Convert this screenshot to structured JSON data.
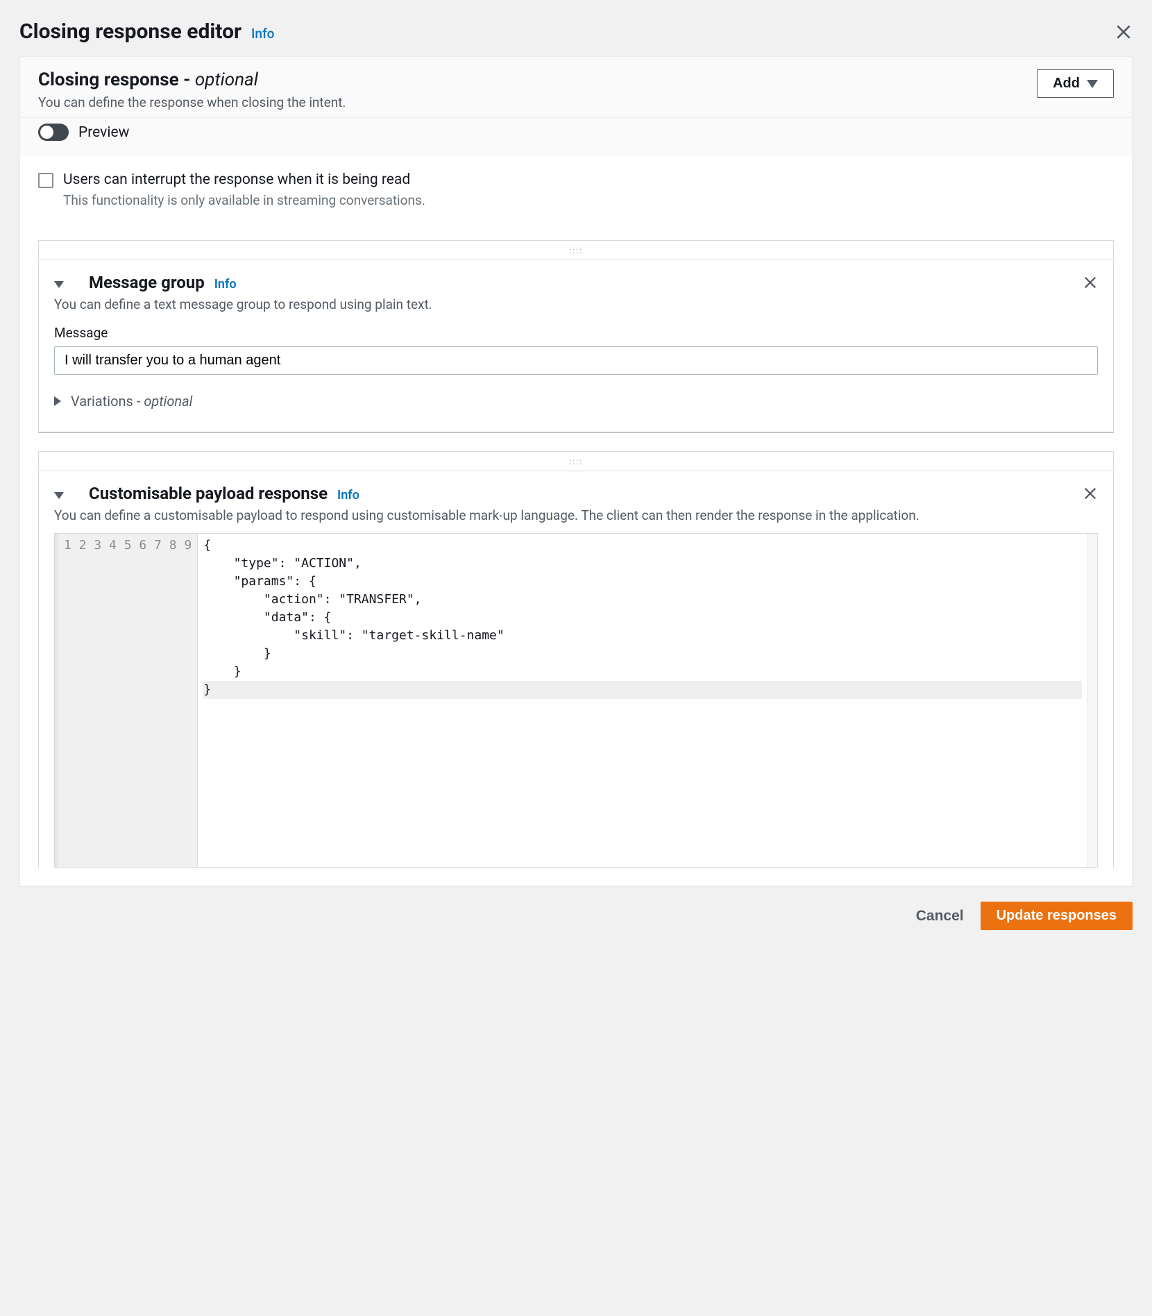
{
  "modal": {
    "title": "Closing response editor",
    "info": "Info"
  },
  "panel": {
    "heading": "Closing response - ",
    "optional": "optional",
    "description": "You can define the response when closing the intent.",
    "add_button": "Add",
    "preview_label": "Preview"
  },
  "interrupt": {
    "label": "Users can interrupt the response when it is being read",
    "desc": "This functionality is only available in streaming conversations."
  },
  "message_group": {
    "title": "Message group",
    "info": "Info",
    "desc": "You can define a text message group to respond using plain text.",
    "field_label": "Message",
    "field_value": "I will transfer you to a human agent",
    "variations_label": "Variations - ",
    "variations_optional": "optional"
  },
  "payload": {
    "title": "Customisable payload response",
    "info": "Info",
    "desc": "You can define a customisable payload to respond using customisable mark-up language. The client can then render the response in the application.",
    "line_numbers": [
      "1",
      "2",
      "3",
      "4",
      "5",
      "6",
      "7",
      "8",
      "9"
    ],
    "code_lines": [
      "{",
      "    \"type\": \"ACTION\",",
      "    \"params\": {",
      "        \"action\": \"TRANSFER\",",
      "        \"data\": {",
      "            \"skill\": \"target-skill-name\"",
      "        }",
      "    }",
      "}"
    ]
  },
  "footer": {
    "cancel": "Cancel",
    "update": "Update responses"
  }
}
